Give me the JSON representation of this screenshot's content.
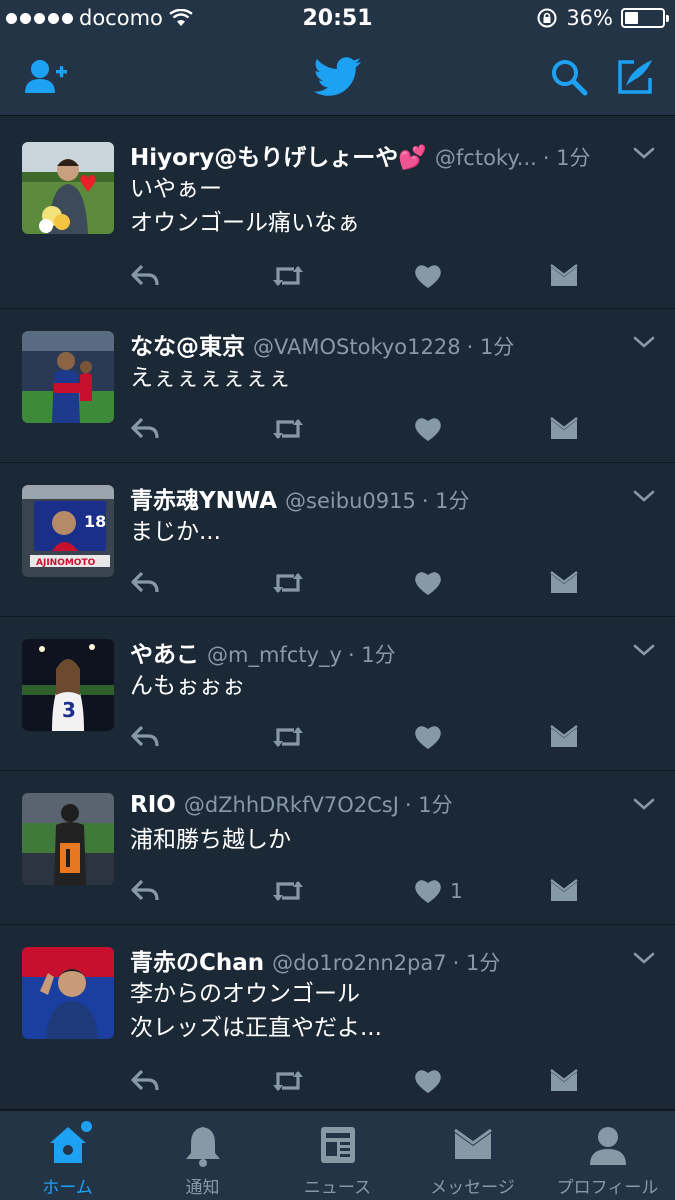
{
  "status": {
    "carrier": "docomo",
    "time": "20:51",
    "battery": "36%",
    "battery_level": 0.36
  },
  "colors": {
    "accent": "#1da1f2",
    "muted": "#8899a6",
    "bar": "#243447",
    "card": "#1b2836"
  },
  "tweets": [
    {
      "name": "Hiyory@もりげしょーや💕",
      "handle": "@fctoky...",
      "time": "· 1分",
      "text": "いやぁー\nオウンゴール痛いなぁ",
      "likes": ""
    },
    {
      "name": "なな@東京",
      "handle": "@VAMOStokyo1228",
      "time": "· 1分",
      "text": "えぇぇぇぇぇぇ",
      "likes": ""
    },
    {
      "name": "青赤魂YNWA",
      "handle": "@seibu0915",
      "time": "· 1分",
      "text": "まじか...",
      "likes": ""
    },
    {
      "name": "やあこ",
      "handle": "@m_mfcty_y",
      "time": "· 1分",
      "text": "んもぉぉぉ",
      "likes": ""
    },
    {
      "name": "RIO",
      "handle": "@dZhhDRkfV7O2CsJ",
      "time": "· 1分",
      "text": "浦和勝ち越しか",
      "likes": "1"
    },
    {
      "name": "青赤のChan",
      "handle": "@do1ro2nn2pa7",
      "time": "· 1分",
      "text": "李からのオウンゴール\n次レッズは正直やだよ...",
      "likes": ""
    }
  ],
  "tabs": [
    {
      "label": "ホーム",
      "icon": "home-icon"
    },
    {
      "label": "通知",
      "icon": "bell-icon"
    },
    {
      "label": "ニュース",
      "icon": "news-icon"
    },
    {
      "label": "メッセージ",
      "icon": "envelope-icon"
    },
    {
      "label": "プロフィール",
      "icon": "person-icon"
    }
  ]
}
